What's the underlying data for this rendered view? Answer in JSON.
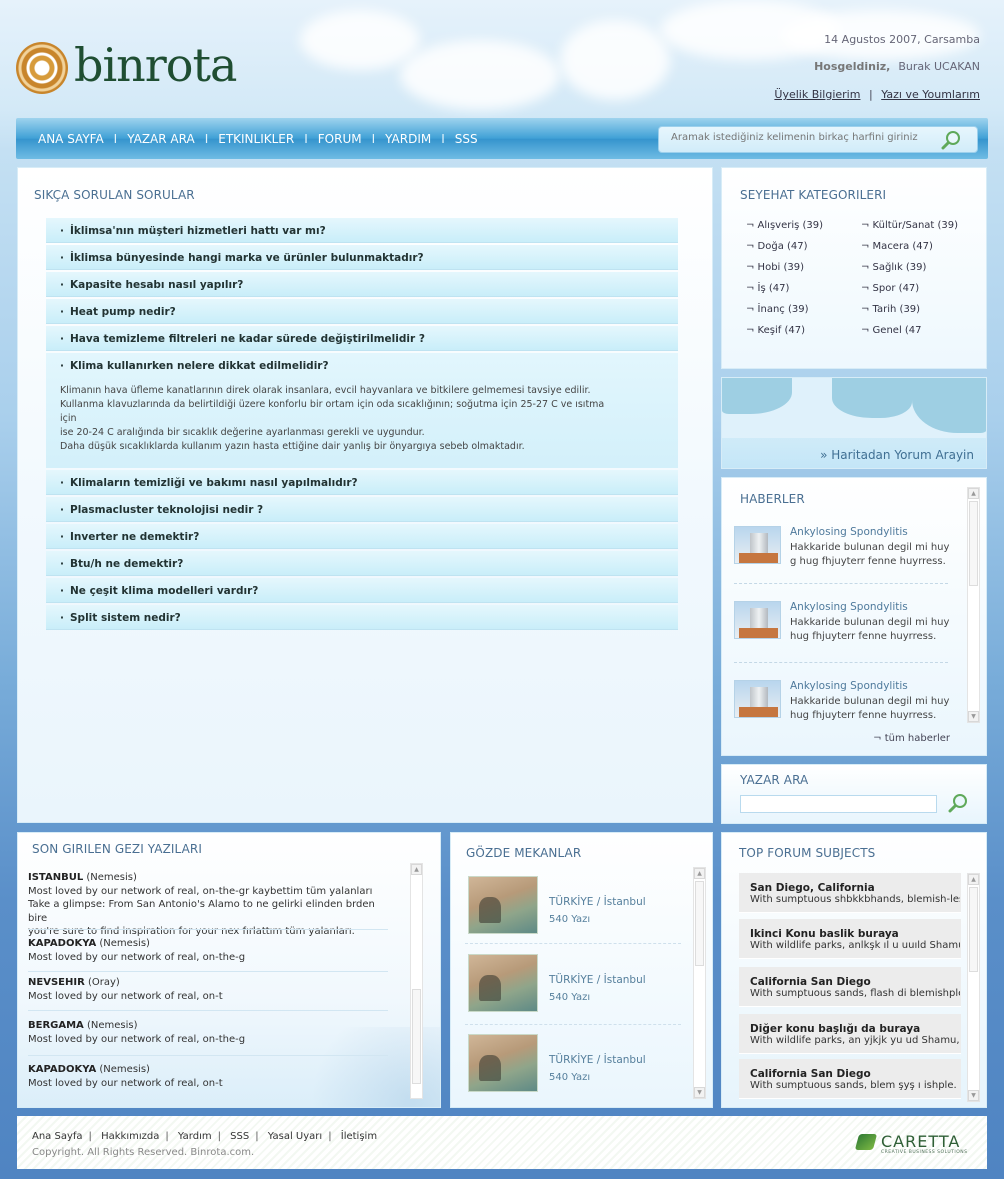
{
  "header": {
    "logo_text": "binrota",
    "date": "14 Agustos 2007, Carsamba",
    "welcome_label": "Hosgeldiniz,",
    "user_name": "Burak UCAKAN",
    "links": [
      "Üyelik Bilgierim",
      "Yazı ve Youmlarım"
    ],
    "link_sep": "|"
  },
  "nav": {
    "items": [
      "ANA SAYFA",
      "YAZAR ARA",
      "ETKINLIKLER",
      "FORUM",
      "YARDIM",
      "SSS"
    ],
    "sep": "I",
    "search_placeholder": "Aramak istediğiniz kelimenin birkaç harfini giriniz"
  },
  "faq": {
    "title": "SIKÇA SORULAN SORULAR",
    "questions_top": [
      "İklimsa'nın müşteri hizmetleri hattı var mı?",
      "İklimsa bünyesinde hangi marka ve ürünler bulunmaktadır?",
      "Kapasite hesabı nasıl yapılır?",
      "Heat pump nedir?",
      "Hava temizleme filtreleri ne kadar sürede değiştirilmelidir ?"
    ],
    "open_question": "Klima kullanırken nelere dikkat edilmelidir?",
    "open_answer": [
      "Klimanın hava üfleme kanatlarının direk olarak insanlara, evcil hayvanlara ve bitkilere gelmemesi  tavsiye edilir.",
      "Kullanma klavuzlarında da belirtildiği üzere konforlu bir ortam için oda sıcaklığının; soğutma için 25-27 C ve ısıtma için",
      "ise 20-24 C aralığında bir sıcaklık değerine ayarlanması gerekli ve  uygundur.",
      "Daha düşük sıcaklıklarda kullanım yazın hasta ettiğine dair yanlış bir önyargıya sebeb olmaktadır."
    ],
    "questions_bottom": [
      "Klimaların temizliği ve bakımı nasıl yapılmalıdır?",
      "Plasmacluster teknolojisi nedir ?",
      "Inverter ne demektir?",
      "Btu/h ne demektir?",
      "Ne çeşit klima modelleri vardır?",
      "Split sistem nedir?"
    ]
  },
  "categories": {
    "title": "SEYEHAT KATEGORILERI",
    "items": [
      "¬ Alışveriş  (39)",
      "¬ Kültür/Sanat (39)",
      "¬ Doğa (47)",
      "¬ Macera (47)",
      "¬ Hobi (39)",
      "¬ Sağlık (39)",
      "¬ İş (47)",
      "¬ Spor (47)",
      "¬ İnanç (39)",
      "¬ Tarih (39)",
      "¬ Keşif (47)",
      "¬ Genel (47"
    ]
  },
  "map": {
    "link": "» Haritadan Yorum Arayin"
  },
  "news": {
    "title": "HABERLER",
    "items": [
      {
        "title": "Ankylosing Spondylitis",
        "desc": "Hakkaride bulunan degil mi huy g hug fhjuyterr fenne huyrress."
      },
      {
        "title": "Ankylosing Spondylitis",
        "desc": "Hakkaride bulunan degil mi huy hug fhjuyterr fenne huyrress."
      },
      {
        "title": "Ankylosing Spondylitis",
        "desc": "Hakkaride bulunan degil mi huy hug fhjuyterr fenne huyrress."
      }
    ],
    "all_link": "¬ tüm haberler"
  },
  "author_search": {
    "title": "YAZAR ARA"
  },
  "recent": {
    "title": "SON GIRILEN GEZI YAZILARI",
    "items": [
      {
        "city": "ISTANBUL",
        "author": " (Nemesis)",
        "lines": [
          "Most loved by our network of real, on-the-gr kaybettim tüm yalanları",
          "Take a glimpse: From San Antonio's Alamo to ne gelirki elinden brden bire",
          "you're sure to find inspiration for your nex fırlattım tüm yalanları."
        ]
      },
      {
        "city": "KAPADOKYA",
        "author": " (Nemesis)",
        "lines": [
          "Most loved by our network of real, on-the-g"
        ]
      },
      {
        "city": "NEVSEHIR",
        "author": " (Oray)",
        "lines": [
          "Most loved by our network of real, on-t"
        ]
      },
      {
        "city": "BERGAMA",
        "author": " (Nemesis)",
        "lines": [
          "Most loved by our network of real, on-the-g"
        ]
      },
      {
        "city": "KAPADOKYA",
        "author": " (Nemesis)",
        "lines": [
          "Most loved by our network of real, on-t"
        ]
      }
    ]
  },
  "places": {
    "title": "GÖZDE MEKANLAR",
    "items": [
      {
        "loc": "TÜRKİYE / İstanbul",
        "count": "540 Yazı"
      },
      {
        "loc": "TÜRKİYE / İstanbul",
        "count": "540 Yazı"
      },
      {
        "loc": "TÜRKİYE / İstanbul",
        "count": "540 Yazı"
      }
    ]
  },
  "forum": {
    "title": "TOP FORUM SUBJECTS",
    "items": [
      {
        "title": "San Diego, California",
        "desc": "With sumptuous shbkkbhands, blemish-less"
      },
      {
        "title": "Ikinci Konu baslik buraya",
        "desc": "With wildlife parks, anlkşk ıl u  uuıld Shamu,"
      },
      {
        "title": "California San Diego",
        "desc": "With sumptuous sands, flash di blemishple."
      },
      {
        "title": "Diğer konu başlığı da buraya",
        "desc": "With wildlife parks, an yjkjk yu  ud Shamu,"
      },
      {
        "title": "California San Diego",
        "desc": "With sumptuous sands, blem şyş ı ishple."
      }
    ]
  },
  "footer": {
    "links": [
      "Ana Sayfa",
      "Hakkımızda",
      "Yardım",
      "SSS",
      "Yasal Uyarı",
      "İletişim"
    ],
    "sep": "|",
    "copyright": "Copyright. All Rights Reserved. Binrota.com.",
    "brand": "CARETTA",
    "brand_sub": "CREATIVE BUSINESS SOLUTIONS"
  },
  "colors": {
    "nav_bar": "#3594cd",
    "panel_title": "#4a6f92",
    "faq_row": "#c9eef9",
    "footer_logo": "#2f7a34"
  },
  "icons": {
    "search": "magnifier-icon",
    "scroll_up": "arrow-up-icon",
    "scroll_down": "arrow-down-icon"
  }
}
